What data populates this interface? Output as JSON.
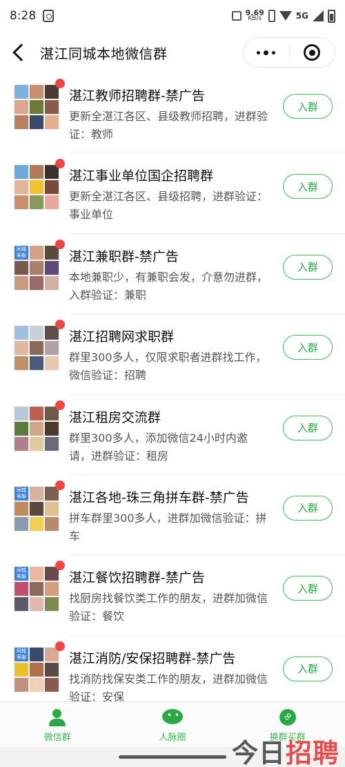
{
  "status_bar": {
    "time": "8:28",
    "net_speed_value": "9.69",
    "net_speed_unit": "KB/s",
    "network": "5G"
  },
  "header": {
    "title": "湛江同城本地微信群"
  },
  "colors": {
    "accent_green": "#3cb953",
    "unread_red": "#f04545",
    "city_tile_blue": "#3a7fd6"
  },
  "city_tile_text": [
    "同城",
    "客服"
  ],
  "join_label": "入群",
  "groups": [
    {
      "title": "湛江教师招聘群-禁广告",
      "desc": "更新全湛江各区、县级教师招聘，进群验证：教师"
    },
    {
      "title": "湛江事业单位国企招聘群",
      "desc": "更新全湛江各区、县级招聘，进群验证：事业单位"
    },
    {
      "title": "湛江兼职群-禁广告",
      "desc": "本地兼职少，有兼职会发，介意勿进群，入群验证：兼职"
    },
    {
      "title": "湛江招聘网求职群",
      "desc": "群里300多人，仅限求职者进群找工作，微信验证：招聘"
    },
    {
      "title": "湛江租房交流群",
      "desc": "群里300多人，添加微信24小时内邀请，进群验证：租房"
    },
    {
      "title": "湛江各地-珠三角拼车群-禁广告",
      "desc": "拼车群里300多人，进群加微信验证：拼车"
    },
    {
      "title": "湛江餐饮招聘群-禁广告",
      "desc": "找厨房找餐饮类工作的朋友，进群加微信验证：餐饮"
    },
    {
      "title": "湛江消防/安保招聘群-禁广告",
      "desc": "找消防找保安类工作的朋友，进群加微信验证：安保"
    }
  ],
  "tabs": [
    {
      "label": "微信群",
      "icon": "group-icon"
    },
    {
      "label": "人脉圈",
      "icon": "chat-icon"
    },
    {
      "label": "换群买群",
      "icon": "link-icon"
    }
  ],
  "watermark": {
    "part1": "今日",
    "part2": "招聘"
  }
}
